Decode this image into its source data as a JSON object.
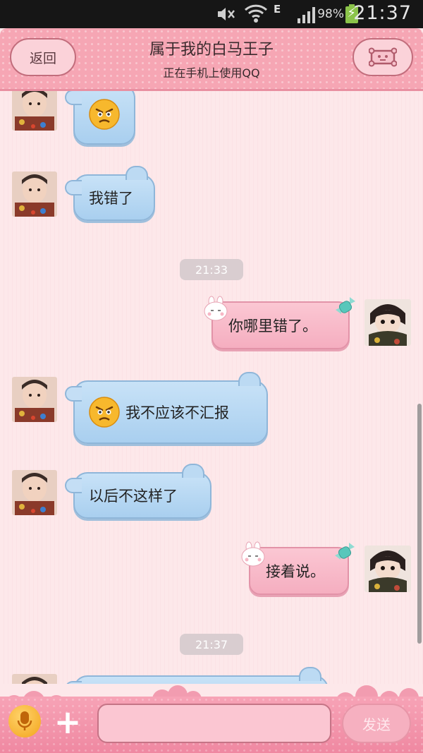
{
  "status_bar": {
    "battery_percent": "98%",
    "time": "21:37",
    "network_type": "E"
  },
  "header": {
    "back_label": "返回",
    "title": "属于我的白马王子",
    "subtitle": "正在手机上使用QQ",
    "profile_icon": "profile-icon"
  },
  "messages": [
    {
      "side": "left",
      "kind": "emoji",
      "emoji": "frown-face-emoji",
      "text": ""
    },
    {
      "side": "left",
      "kind": "text",
      "text": "我错了"
    },
    {
      "side": "center",
      "kind": "time",
      "text": "21:33"
    },
    {
      "side": "right",
      "kind": "text",
      "text": "你哪里错了。"
    },
    {
      "side": "left",
      "kind": "emoji_text",
      "emoji": "frown-face-emoji",
      "text": "我不应该不汇报"
    },
    {
      "side": "left",
      "kind": "text",
      "text": "以后不这样了"
    },
    {
      "side": "right",
      "kind": "text",
      "text": "接着说。"
    },
    {
      "side": "center",
      "kind": "time",
      "text": "21:37"
    }
  ],
  "composer": {
    "input_value": "",
    "send_label": "发送",
    "voice_icon": "microphone-icon",
    "plus_icon": "plus-icon"
  },
  "colors": {
    "header_pink": "#f6a6b4",
    "left_bubble_blue": "#b8d9f3",
    "right_bubble_pink": "#f8b9c8",
    "background": "#fde8ea"
  }
}
